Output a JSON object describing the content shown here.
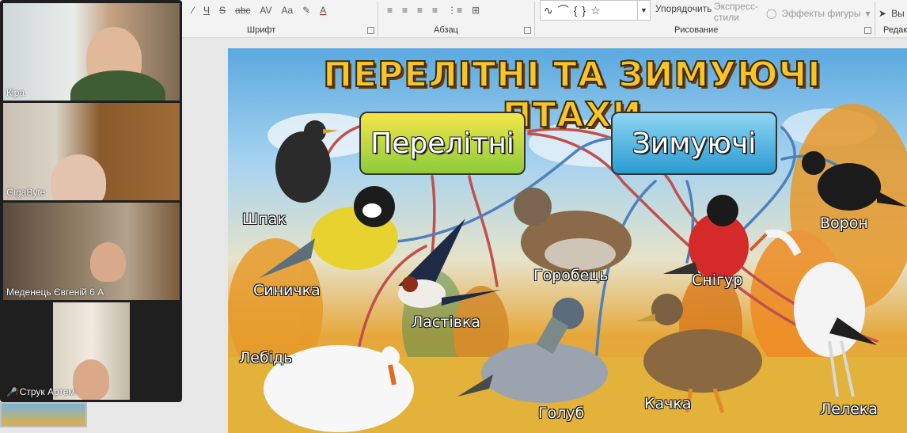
{
  "ribbon": {
    "font_tools": [
      "Ч",
      "S",
      "abc",
      "AV",
      "Aa"
    ],
    "group_font": "Шрифт",
    "group_paragraph": "Абзац",
    "group_drawing": "Рисование",
    "group_edit": "Редак",
    "arrange_label": "Упорядочить",
    "quick_styles_label": "Экспресс-стили",
    "shape_effects_label": "Эффекты фигуры",
    "select_label": "Вы"
  },
  "participants": [
    {
      "name": "Кіра",
      "muted": false
    },
    {
      "name": "GigaByte",
      "muted": false
    },
    {
      "name": "Меденець Євгеній 6 А",
      "muted": false
    },
    {
      "name": "Струк Артем",
      "muted": true
    }
  ],
  "slide": {
    "title": "ПЕРЕЛІТНІ ТА ЗИМУЮЧІ ПТАХИ",
    "box_migratory": "Перелітні",
    "box_wintering": "Зимуючі",
    "birds": {
      "shpak": "Шпак",
      "synychka": "Синичка",
      "lastivka": "Ластівка",
      "horobets": "Горобець",
      "snihur": "Снігур",
      "voron": "Ворон",
      "lebid": "Лебідь",
      "holub": "Голуб",
      "kachka": "Качка",
      "leleka": "Лелека"
    },
    "colors": {
      "migratory_arrow": "#c0504d",
      "wintering_arrow": "#4f81bd"
    }
  }
}
